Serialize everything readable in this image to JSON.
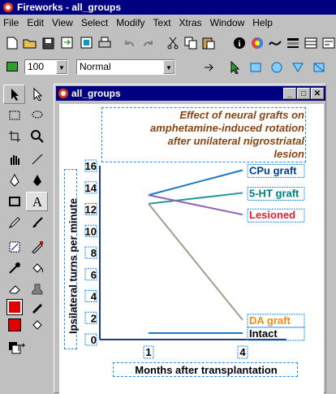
{
  "app": {
    "title": "Fireworks - all_groups"
  },
  "menu": [
    "File",
    "Edit",
    "View",
    "Select",
    "Modify",
    "Text",
    "Xtras",
    "Window",
    "Help"
  ],
  "toolbar2": {
    "zoom": "100",
    "blend": "Normal"
  },
  "document": {
    "title": "all_groups"
  },
  "chart_data": {
    "type": "line",
    "title": "Effect of neural grafts on amphetamine-induced rotation after unilateral nigrostriatal lesion",
    "title_lines": [
      "Effect of neural grafts on",
      "amphetamine-induced rotation",
      "after unilateral nigrostriatal",
      "lesion"
    ],
    "xlabel": "Months after transplantation",
    "ylabel": "Ipsilateral turns per minute",
    "x": [
      1,
      4
    ],
    "x_ticks": [
      "1",
      "4"
    ],
    "y_ticks": [
      "0",
      "2",
      "4",
      "6",
      "8",
      "10",
      "12",
      "14",
      "16"
    ],
    "ylim": [
      0,
      16
    ],
    "series": [
      {
        "name": "CPu graft",
        "values": [
          13.3,
          15.6
        ],
        "color": "#1e78c8",
        "label_color": "#003c8c"
      },
      {
        "name": "5-HT graft",
        "values": [
          12.5,
          13.5
        ],
        "color": "#1e9696",
        "label_color": "#008080"
      },
      {
        "name": "Lesioned",
        "values": [
          13.3,
          11.5
        ],
        "color": "#8c64b4",
        "label_color": "#e61e32"
      },
      {
        "name": "DA graft",
        "values": [
          12.5,
          1.8
        ],
        "color": "#a0a08c",
        "label_color": "#f08c14"
      },
      {
        "name": "Intact",
        "values": [
          0.6,
          0.6
        ],
        "color": "#1e78c8",
        "label_color": "#000000"
      }
    ]
  },
  "colors": {
    "title_text": "#8b4513",
    "axis": "#1c3f7a",
    "titlebar": "#000080"
  }
}
